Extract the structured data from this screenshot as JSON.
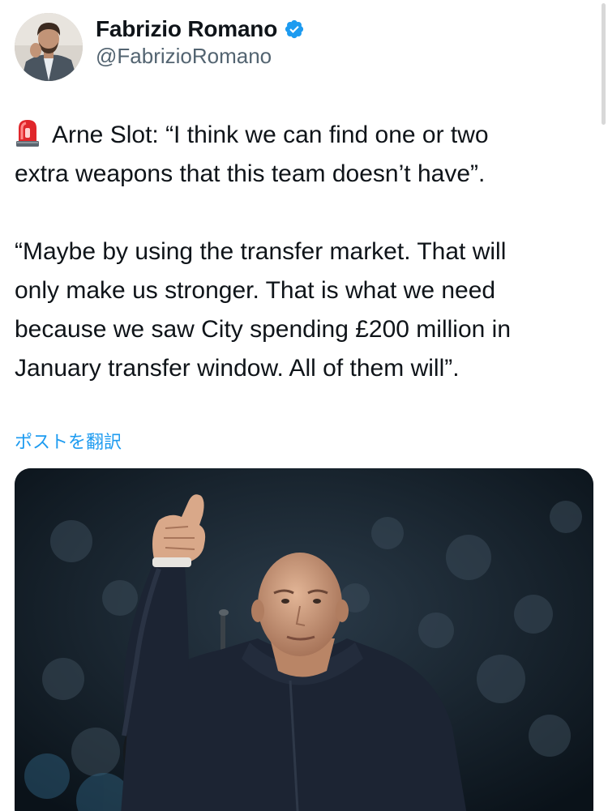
{
  "author": {
    "display_name": "Fabrizio Romano",
    "handle": "@FabrizioRomano",
    "verified_icon": "verified-badge-icon",
    "avatar_icon": "profile-photo"
  },
  "tweet": {
    "emoji_icon": "rotating-light-emoji",
    "lines": [
      "Arne Slot: “I think we can find one or two",
      "extra weapons that this team doesn’t have”.",
      "“Maybe by using the transfer market. That will",
      "only make us stronger. That is what we need",
      "because we saw City spending £200 million in",
      "January transfer window. All of them will”."
    ]
  },
  "translate_link": "ポストを翻訳",
  "media": {
    "type": "photo",
    "icon": "man-thumbs-up-photo"
  },
  "colors": {
    "link": "#1d9bf0",
    "verified": "#1d9bf0",
    "secondary_text": "#536471"
  }
}
